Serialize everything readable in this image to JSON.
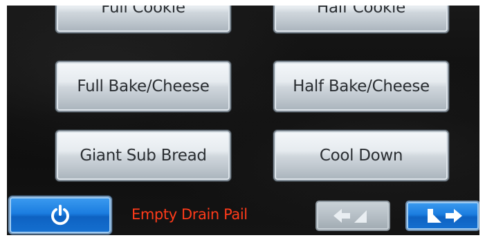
{
  "menu": {
    "full_cookie": "Full Cookie",
    "half_cookie": "Half Cookie",
    "full_bake_cheese": "Full Bake/Cheese",
    "half_bake_cheese": "Half Bake/Cheese",
    "giant_sub_bread": "Giant Sub Bread",
    "cool_down": "Cool Down"
  },
  "footer": {
    "status_message": "Empty Drain Pail",
    "power_icon": "power-icon",
    "back_icon": "arrow-left-icon",
    "next_icon": "arrow-right-icon"
  },
  "colors": {
    "background": "#111111",
    "button_face": "#d6dde3",
    "button_text": "#2a2e32",
    "accent_blue": "#1b7de0",
    "status_red": "#ff3b1a",
    "disabled_nav": "#b6bfc6"
  }
}
